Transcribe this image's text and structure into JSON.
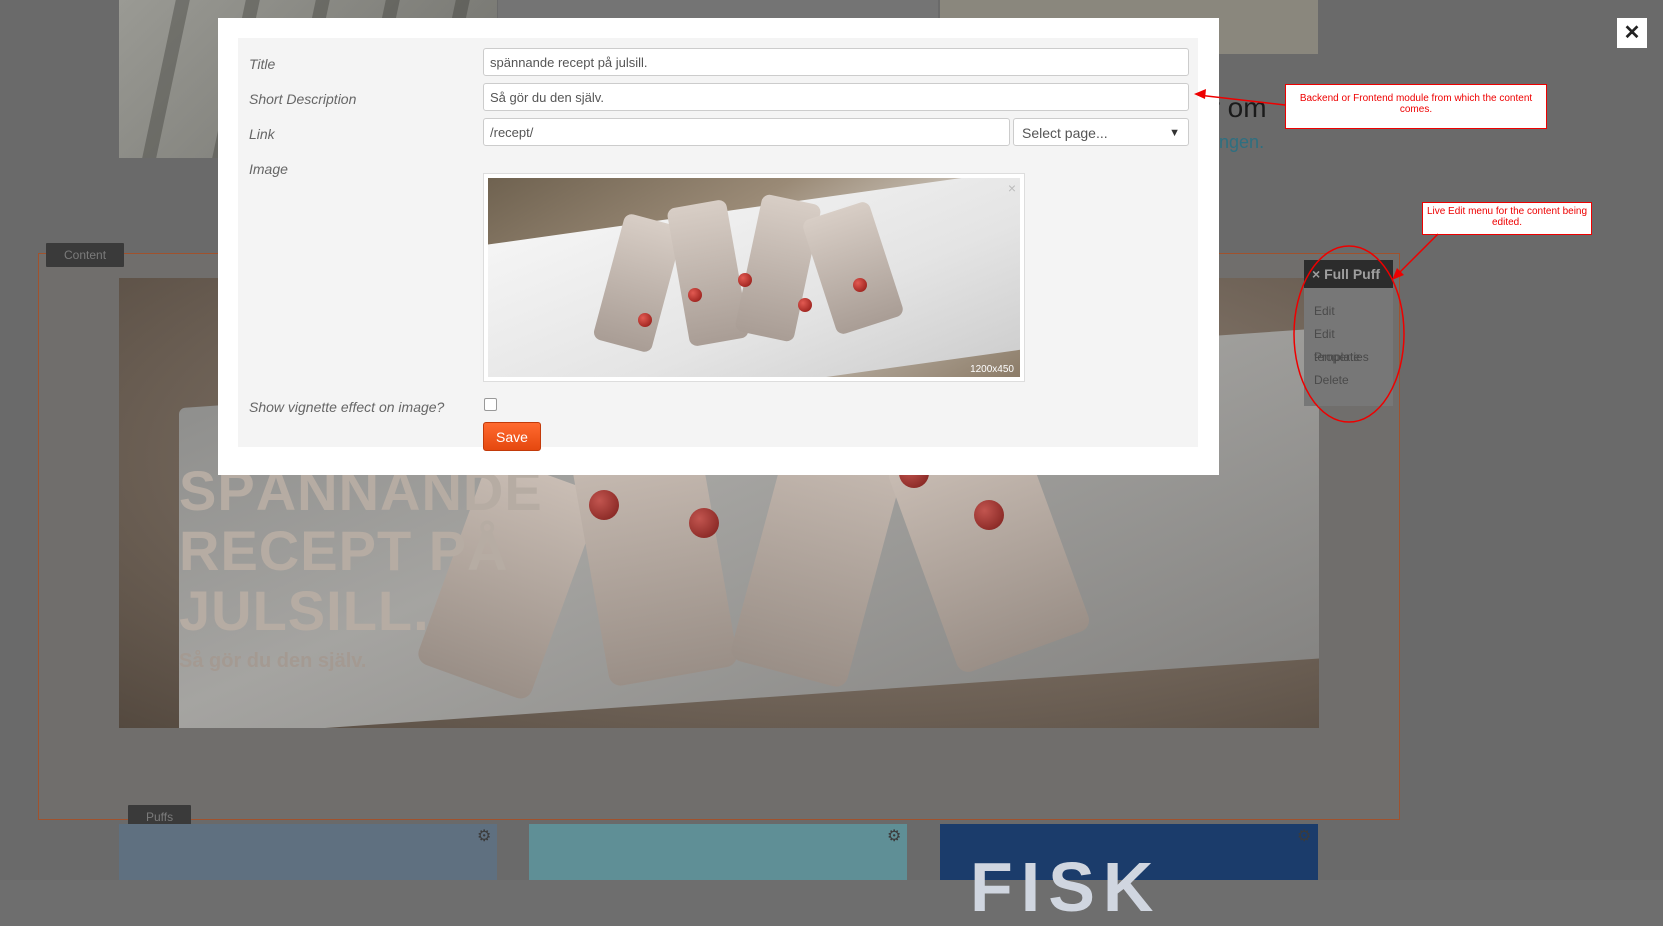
{
  "background": {
    "right_heading_fragment": "er om",
    "right_link_fragment": "nningen.",
    "hero_title_lines": [
      "SPÄNNANDE",
      "RECEPT PÅ",
      "JULSILL."
    ],
    "hero_subtitle": "Så gör du den själv.",
    "puff3_text": "FISK"
  },
  "zones": {
    "content_label": "Content",
    "puffs_label": "Puffs"
  },
  "live_edit_menu": {
    "header": "× Full Puff",
    "items": [
      "Edit",
      "Edit template",
      "Properties",
      "Delete"
    ]
  },
  "modal": {
    "close_label": "✕",
    "fields": {
      "title_label": "Title",
      "title_value": "spännande recept på julsill.",
      "short_description_label": "Short Description",
      "short_description_value": "Så gör du den själv.",
      "link_label": "Link",
      "link_value": "/recept/",
      "select_page_placeholder": "Select page...",
      "image_label": "Image",
      "image_size": "1200x450",
      "image_remove": "×",
      "vignette_label": "Show vignette effect on image?",
      "vignette_checked": false
    },
    "save_label": "Save"
  },
  "annotations": {
    "module_note": "Backend or Frontend module from which the content comes.",
    "live_edit_note": "Live Edit menu for the content being edited."
  },
  "colors": {
    "accent_save": "#e5480f",
    "annotation_red": "#ee0000",
    "zone_border": "#a0522d"
  }
}
